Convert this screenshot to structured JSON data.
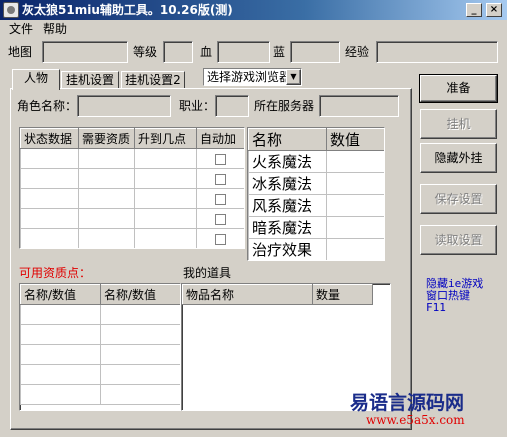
{
  "window": {
    "title": "灰太狼51miu辅助工具。10.26版(测)",
    "minimize": "_",
    "close": "×"
  },
  "menu": [
    "文件",
    "帮助"
  ],
  "status": {
    "map_label": "地图",
    "level_label": "等级",
    "hp_label": "血",
    "mp_label": "蓝",
    "exp_label": "经验"
  },
  "tabs": [
    "人物",
    "挂机设置",
    "挂机设置2"
  ],
  "browser_select": "选择游戏浏览器",
  "character": {
    "name_label": "角色名称：",
    "job_label": "职业：",
    "server_label": "所在服务器"
  },
  "attr_table": {
    "headers": [
      "状态数据",
      "需要资质",
      "升到几点",
      "自动加"
    ],
    "row_count": 5
  },
  "skills": {
    "headers": [
      "名称",
      "数值"
    ],
    "items": [
      "火系魔法",
      "冰系魔法",
      "风系魔法",
      "暗系魔法",
      "治疗效果"
    ]
  },
  "points_label": "可用资质点：",
  "items_label": "我的道具",
  "points_table": {
    "headers": [
      "名称/数值",
      "名称/数值"
    ]
  },
  "items_table": {
    "headers": [
      "物品名称",
      "数量"
    ]
  },
  "buttons": {
    "ready": "准备",
    "hangup": "挂机",
    "hide": "隐藏外挂",
    "save": "保存设置",
    "load": "读取设置"
  },
  "hotkey_note": [
    "隐藏ie游戏",
    "窗口热键",
    "F11"
  ],
  "watermark": {
    "title": "易语言源码网",
    "url": "www.e5a5x.com"
  }
}
